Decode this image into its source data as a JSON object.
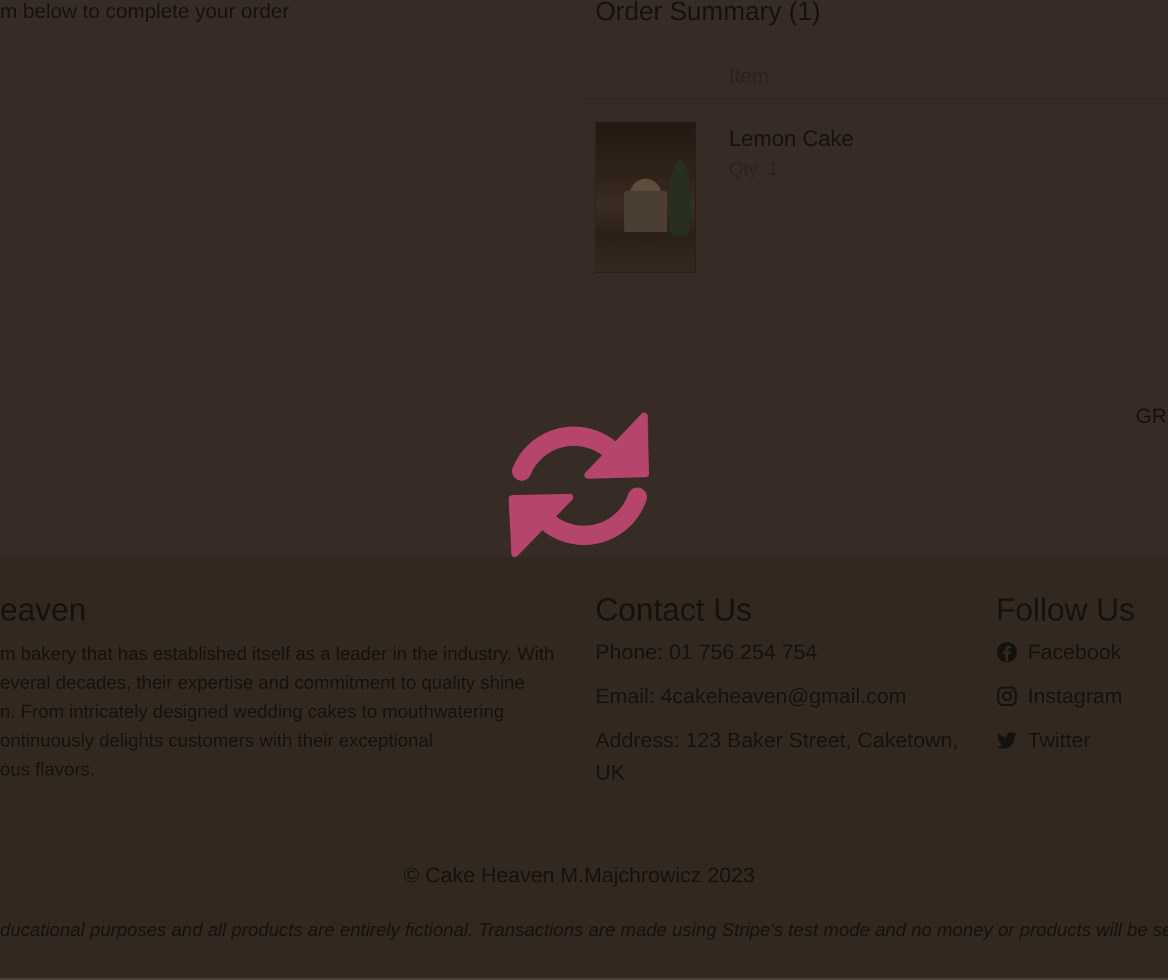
{
  "checkout": {
    "form_intro": "m below to complete your order",
    "summary_title": "Order Summary (1)",
    "item_col_header": "Item",
    "items": [
      {
        "name": "Lemon Cake",
        "qty": "Qty: 1"
      }
    ],
    "grand_total_label": "GR"
  },
  "overlay": {
    "icon": "sync-icon",
    "icon_color": "#b5456a"
  },
  "footer": {
    "about": {
      "title": "eaven",
      "lines": [
        "m bakery that has established itself as a leader in the industry. With",
        "everal decades, their expertise and commitment to quality shine",
        "n. From intricately designed wedding cakes to mouthwatering",
        "ontinuously delights customers with their exceptional",
        "ous flavors."
      ]
    },
    "contact": {
      "title": "Contact Us",
      "phone": "Phone: 01 756 254 754",
      "email": "Email: 4cakeheaven@gmail.com",
      "address_line1": "Address: 123 Baker Street, Caketown,",
      "address_line2": "UK"
    },
    "follow": {
      "title": "Follow Us",
      "links": [
        {
          "label": "Facebook",
          "icon": "facebook-icon"
        },
        {
          "label": "Instagram",
          "icon": "instagram-icon"
        },
        {
          "label": "Twitter",
          "icon": "twitter-icon"
        }
      ]
    },
    "copyright": "© Cake Heaven M.Majchrowicz 2023",
    "disclaimer": "ducational purposes and all products are entirely fictional. Transactions are made using Stripe's test mode and no money or products will be se"
  }
}
